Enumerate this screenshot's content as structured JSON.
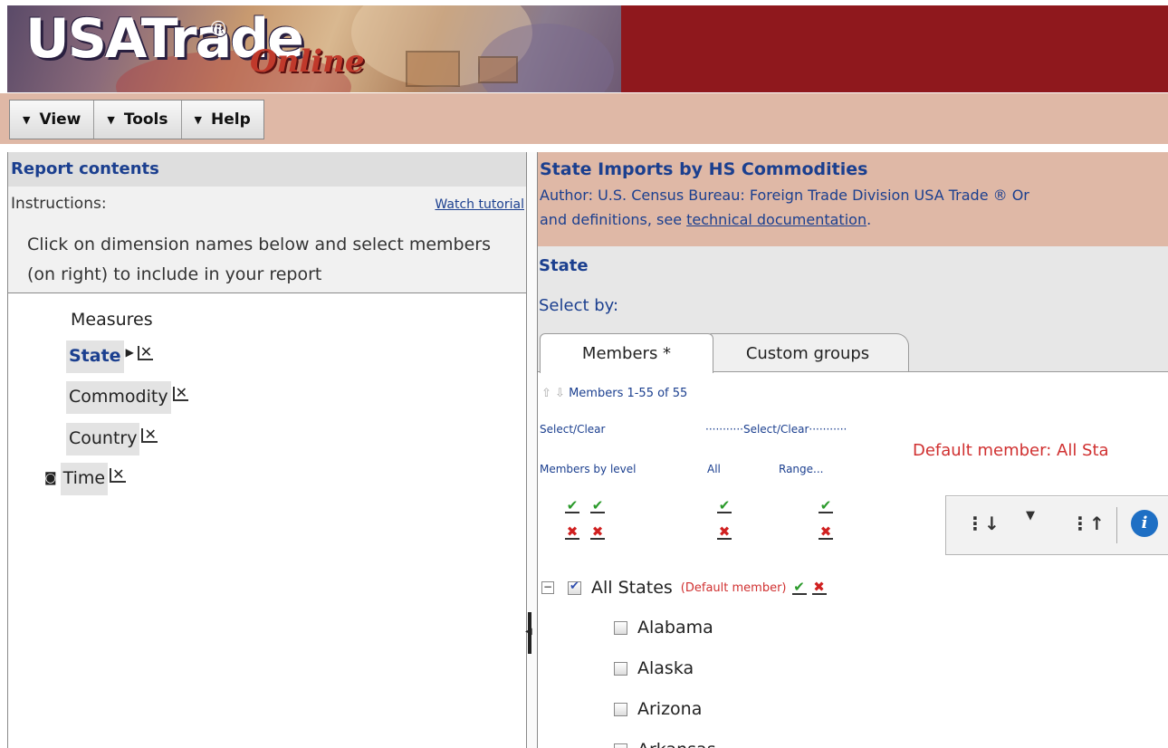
{
  "logo": {
    "usa_text": "USATrade",
    "reg_mark": "®",
    "online_text": "Online"
  },
  "colors": {
    "header_band": "#8f181d",
    "menubar_bg": "#dfb8a6",
    "title_blue": "#1b3f8f",
    "default_red": "#d03030"
  },
  "menu": [
    {
      "label": "View",
      "icon": "dropdown-triangle-icon"
    },
    {
      "label": "Tools",
      "icon": "dropdown-triangle-icon"
    },
    {
      "label": "Help",
      "icon": "dropdown-triangle-icon"
    }
  ],
  "left_panel": {
    "heading": "Report contents",
    "instructions_label": "Instructions:",
    "watch_tutorial": "Watch tutorial",
    "instructions_text": "Click on dimension names below and select members (on right) to include in your report",
    "dimensions": [
      {
        "label": "Measures",
        "selected": false
      },
      {
        "label": "State",
        "selected": true
      },
      {
        "label": "Commodity",
        "selected": false
      },
      {
        "label": "Country",
        "selected": false
      },
      {
        "label": "Time",
        "selected": false
      }
    ]
  },
  "report": {
    "title": "State Imports by HS Commodities",
    "author": "Author: U.S. Census Bureau: Foreign Trade Division USA Trade ® Or",
    "docs_prefix": "and definitions, see ",
    "docs_link": "technical documentation",
    "docs_suffix": "."
  },
  "state_section": {
    "title": "State",
    "select_by": "Select by:",
    "tabs": [
      {
        "label": "Members *",
        "active": true
      },
      {
        "label": "Custom groups",
        "active": false
      }
    ],
    "members_range": "Members 1-55 of 55",
    "select_clear": "Select/Clear",
    "select_clear_2": "···········Select/Clear···········",
    "members_by_level": "Members by level",
    "all_label": "All",
    "range_label": "Range...",
    "default_member_text": "Default member: All Sta",
    "toolbar_icons": [
      "sort-down-icon",
      "dropdown-icon",
      "sort-up-icon",
      "info-icon"
    ]
  },
  "tree": {
    "root": {
      "label": "All States",
      "checked": true,
      "tag": "(Default member)"
    },
    "states": [
      "Alabama",
      "Alaska",
      "Arizona",
      "Arkansas"
    ]
  }
}
